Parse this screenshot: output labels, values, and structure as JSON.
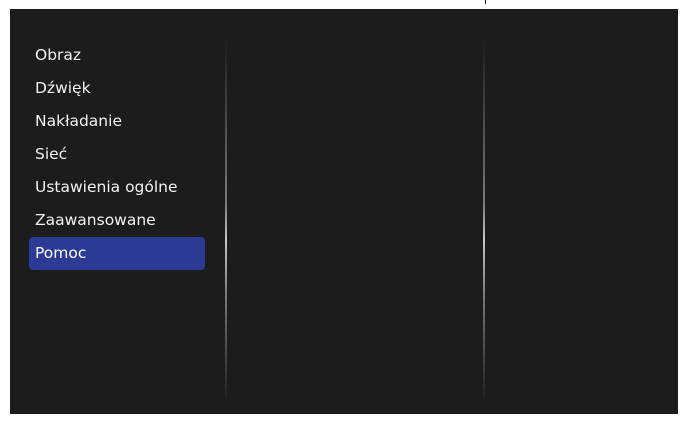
{
  "menu": {
    "items": [
      {
        "label": "Obraz",
        "selected": false
      },
      {
        "label": "Dźwięk",
        "selected": false
      },
      {
        "label": "Nakładanie",
        "selected": false
      },
      {
        "label": "Sieć",
        "selected": false
      },
      {
        "label": "Ustawienia ogólne",
        "selected": false
      },
      {
        "label": "Zaawansowane",
        "selected": false
      },
      {
        "label": "Pomoc",
        "selected": true
      }
    ]
  },
  "colors": {
    "background": "#1c1c1c",
    "selection": "#2b3a94",
    "text": "#f2f2f2"
  }
}
